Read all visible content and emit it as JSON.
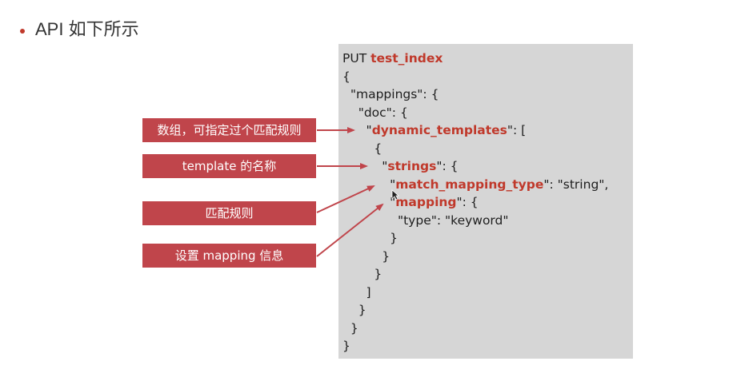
{
  "header": {
    "title": "API 如下所示"
  },
  "code": {
    "lines": [
      {
        "pre": "PUT ",
        "kw": "test_index",
        "post": ""
      },
      {
        "pre": "{",
        "kw": "",
        "post": ""
      },
      {
        "pre": "  \"mappings\": {",
        "kw": "",
        "post": ""
      },
      {
        "pre": "    \"doc\": {",
        "kw": "",
        "post": ""
      },
      {
        "pre": "      \"",
        "kw": "dynamic_templates",
        "post": "\": ["
      },
      {
        "pre": "        {",
        "kw": "",
        "post": ""
      },
      {
        "pre": "          \"",
        "kw": "strings",
        "post": "\": {"
      },
      {
        "pre": "            \"",
        "kw": "match_mapping_type",
        "post": "\": \"string\","
      },
      {
        "pre": "            \"",
        "kw": "mapping",
        "post": "\": {"
      },
      {
        "pre": "              \"type\": \"keyword\"",
        "kw": "",
        "post": ""
      },
      {
        "pre": "            }",
        "kw": "",
        "post": ""
      },
      {
        "pre": "          }",
        "kw": "",
        "post": ""
      },
      {
        "pre": "        }",
        "kw": "",
        "post": ""
      },
      {
        "pre": "      ]",
        "kw": "",
        "post": ""
      },
      {
        "pre": "    }",
        "kw": "",
        "post": ""
      },
      {
        "pre": "  }",
        "kw": "",
        "post": ""
      },
      {
        "pre": "}",
        "kw": "",
        "post": ""
      }
    ]
  },
  "annotations": [
    {
      "text": "数组，可指定过个匹配规则"
    },
    {
      "text": "template 的名称"
    },
    {
      "text": "匹配规则"
    },
    {
      "text": "设置 mapping 信息"
    }
  ],
  "colors": {
    "accent": "#c0454b",
    "keyword": "#c0392b",
    "code_bg": "#d6d6d6"
  }
}
